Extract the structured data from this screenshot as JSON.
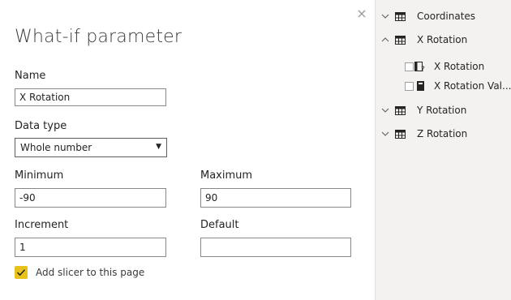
{
  "dialog": {
    "title": "What-if parameter",
    "close_glyph": "×",
    "name_label": "Name",
    "name_value": "X Rotation",
    "datatype_label": "Data type",
    "datatype_value": "Whole number",
    "caret_glyph": "▼",
    "minimum_label": "Minimum",
    "minimum_value": "-90",
    "maximum_label": "Maximum",
    "maximum_value": "90",
    "increment_label": "Increment",
    "increment_value": "1",
    "default_label": "Default",
    "default_value": "",
    "slicer_label": "Add slicer to this page",
    "slicer_checked": true,
    "accent": "#e8c11c"
  },
  "fields_pane": {
    "items": [
      {
        "label": "Coordinates",
        "expanded": false,
        "icon": "table-icon"
      },
      {
        "label": "X Rotation",
        "expanded": true,
        "icon": "table-icon",
        "children": [
          {
            "label": "X Rotation",
            "icon": "parameter-icon"
          },
          {
            "label": "X Rotation Val...",
            "icon": "calculator-icon"
          }
        ]
      },
      {
        "label": "Y Rotation",
        "expanded": false,
        "icon": "table-icon"
      },
      {
        "label": "Z Rotation",
        "expanded": false,
        "icon": "table-icon"
      }
    ]
  }
}
